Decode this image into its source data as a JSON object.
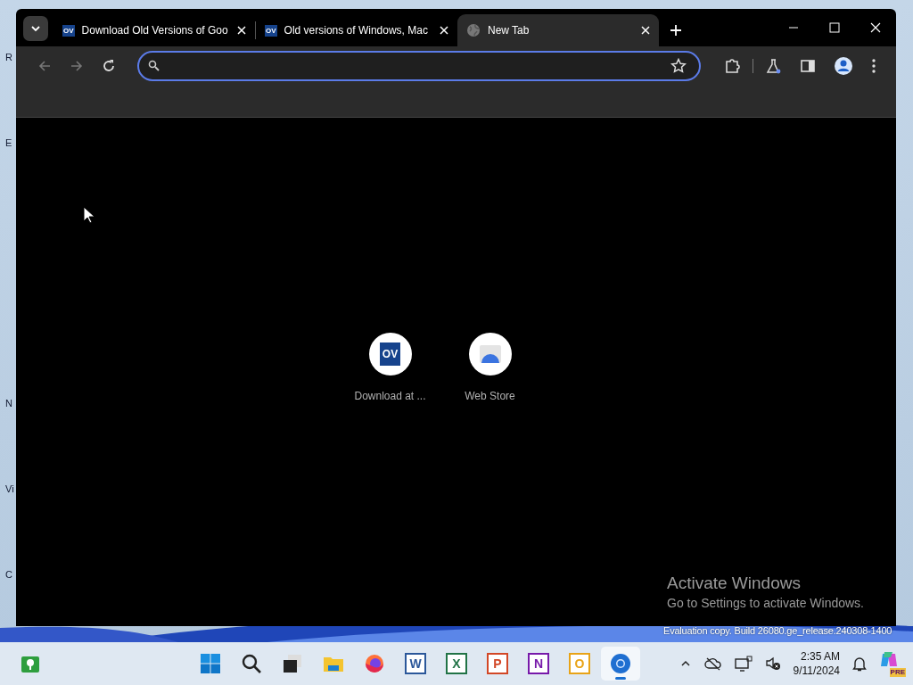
{
  "desktop_labels": [
    "R",
    "E",
    "N",
    "Vi",
    "C"
  ],
  "browser": {
    "tabs": [
      {
        "title": "Download Old Versions of Goo",
        "kind": "ov",
        "icon_text": "OV",
        "selected": false
      },
      {
        "title": "Old versions of Windows, Mac",
        "kind": "ov",
        "icon_text": "OV",
        "selected": false
      },
      {
        "title": "New Tab",
        "kind": "globe",
        "selected": true
      }
    ],
    "shortcuts": [
      {
        "label": "Download at ...",
        "kind": "ov",
        "icon_text": "OV"
      },
      {
        "label": "Web Store",
        "kind": "store"
      }
    ]
  },
  "activation": {
    "title": "Activate Windows",
    "subtitle": "Go to Settings to activate Windows."
  },
  "build_note": "Evaluation copy. Build 26080.ge_release.240308-1400",
  "taskbar": {
    "apps": [
      {
        "kind": "maps",
        "selected": false
      },
      {
        "kind": "start",
        "selected": false
      },
      {
        "kind": "search",
        "selected": false
      },
      {
        "kind": "taskview",
        "selected": false
      },
      {
        "kind": "explorer",
        "selected": false
      },
      {
        "kind": "firefox",
        "selected": false
      },
      {
        "kind": "office",
        "letter": "W",
        "color": "#2b579a",
        "selected": false
      },
      {
        "kind": "office",
        "letter": "X",
        "color": "#217346",
        "selected": false
      },
      {
        "kind": "office",
        "letter": "P",
        "color": "#d24726",
        "selected": false
      },
      {
        "kind": "office",
        "letter": "N",
        "color": "#7719aa",
        "selected": false
      },
      {
        "kind": "office",
        "letter": "O",
        "color": "#e8a317",
        "selected": false
      },
      {
        "kind": "chrome",
        "selected": true
      }
    ],
    "clock": {
      "time": "2:35 AM",
      "date": "9/11/2024"
    },
    "copilot_badge": "PRE"
  }
}
